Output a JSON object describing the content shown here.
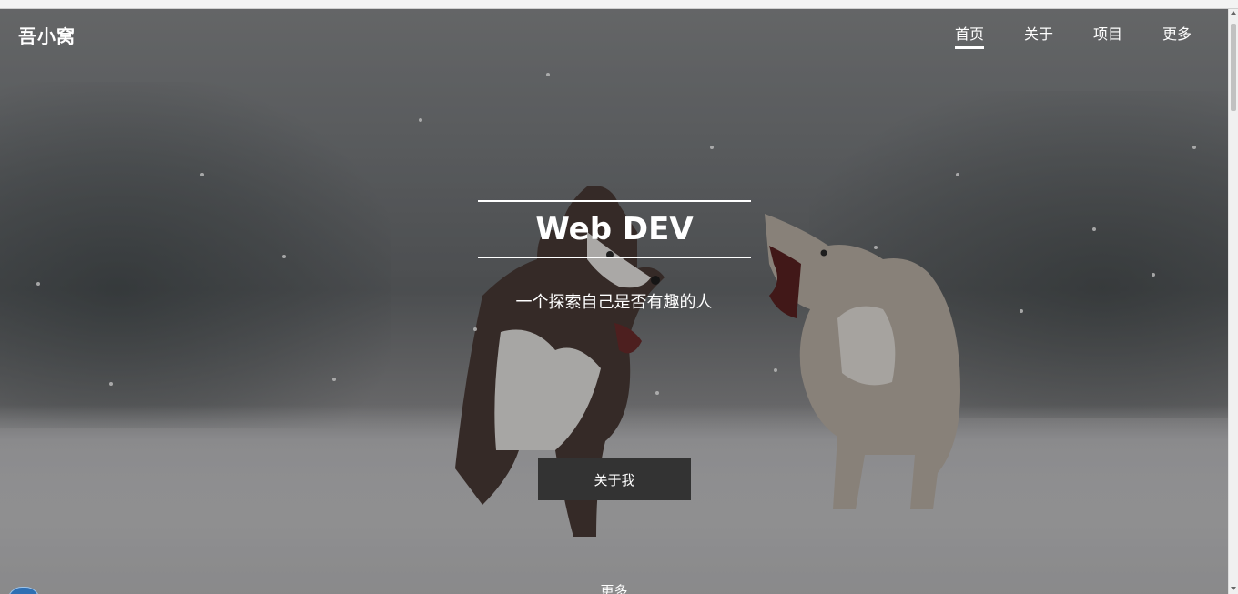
{
  "navbar": {
    "brand": "吾小窝",
    "items": [
      {
        "label": "首页",
        "active": true
      },
      {
        "label": "关于",
        "active": false
      },
      {
        "label": "项目",
        "active": false
      },
      {
        "label": "更多",
        "active": false
      }
    ]
  },
  "hero": {
    "title": "Web DEV",
    "subtitle": "一个探索自己是否有趣的人",
    "button_label": "关于我",
    "more_label": "更多"
  }
}
